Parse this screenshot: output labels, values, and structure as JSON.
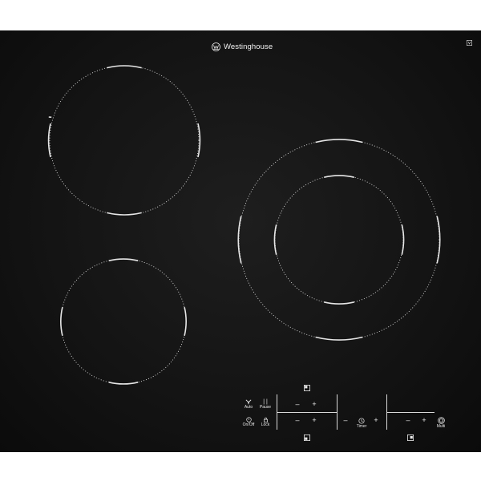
{
  "brand": {
    "name": "Westinghouse"
  },
  "colors": {
    "glass": "#141414",
    "ring": "#e6e6e6",
    "print": "#eaeaea"
  },
  "controls": {
    "auto_label": "Auto",
    "pause_label": "Pause",
    "pause_symbol": "| |",
    "onoff_label": "On/Off",
    "lock_label": "Lock",
    "timer_label": "Timer",
    "multi_label": "Multi",
    "minus": "–",
    "plus": "+"
  },
  "icons": [
    "westinghouse-logo-icon",
    "auto-icon",
    "pause-icon",
    "power-icon",
    "lock-icon",
    "timer-icon",
    "multi-icon",
    "zone-indicator-icon",
    "certification-mark-icon"
  ]
}
